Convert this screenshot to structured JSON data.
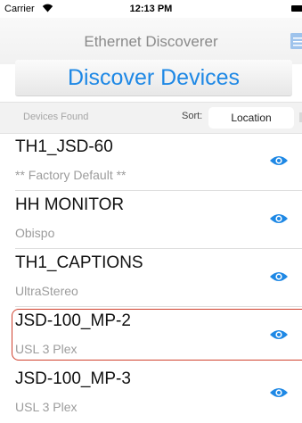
{
  "status_bar": {
    "carrier": "Carrier",
    "time": "12:13 PM",
    "wifi_icon": "wifi-icon",
    "battery_icon": "battery-icon"
  },
  "nav": {
    "title": "Ethernet Discoverer",
    "doc_icon": "document-icon"
  },
  "discover_button": {
    "label": "Discover Devices"
  },
  "filter_bar": {
    "devices_found_label": "Devices Found",
    "sort_label": "Sort:",
    "sort_value": "Location"
  },
  "devices": [
    {
      "name": "TH1_JSD-60",
      "subtitle": "** Factory Default **",
      "selected": false
    },
    {
      "name": "HH MONITOR",
      "subtitle": "Obispo",
      "selected": false
    },
    {
      "name": "TH1_CAPTIONS",
      "subtitle": "UltraStereo",
      "selected": false
    },
    {
      "name": "JSD-100_MP-2",
      "subtitle": "USL 3 Plex",
      "selected": true
    },
    {
      "name": "JSD-100_MP-3",
      "subtitle": "USL 3 Plex",
      "selected": false
    }
  ],
  "colors": {
    "accent": "#1e88e5",
    "selection_border": "#d0412e"
  }
}
